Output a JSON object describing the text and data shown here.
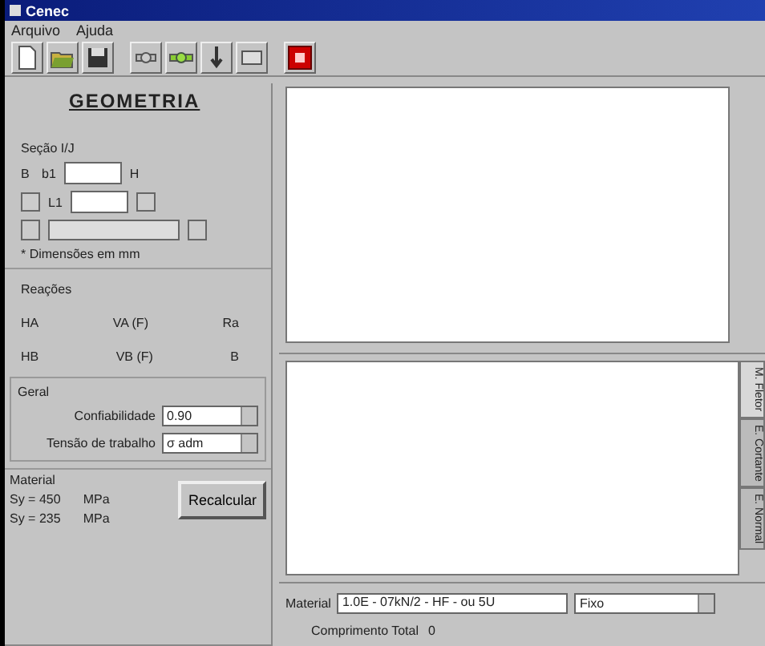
{
  "window": {
    "title": "Cenec"
  },
  "menu": [
    "Arquivo",
    "Ajuda"
  ],
  "toolbar": [
    {
      "kind": "new"
    },
    {
      "kind": "open"
    },
    {
      "kind": "save"
    },
    {
      "kind": "sep"
    },
    {
      "kind": "beam"
    },
    {
      "kind": "beam-green"
    },
    {
      "kind": "load"
    },
    {
      "kind": "support"
    },
    {
      "kind": "sep"
    },
    {
      "kind": "stop"
    }
  ],
  "geometry": {
    "title": "GEOMETRIA",
    "section_label": "Seção I/J",
    "b_label": "B",
    "b1_label": "b1",
    "h_label": "H",
    "l1_label": "L1",
    "checks": [
      {
        "checked": false
      },
      {
        "checked": false
      }
    ],
    "note": "* Dimensões em mm"
  },
  "reactions": {
    "title": "Reações",
    "rows": [
      [
        "HA",
        "VA (F)",
        "Ra"
      ],
      [
        "HB",
        "VB (F)",
        "B"
      ]
    ]
  },
  "general": {
    "title": "Geral",
    "rows": [
      {
        "label": "Confiabilidade",
        "value": "0.90"
      },
      {
        "label": "Tensão de trabalho",
        "value": "σ adm"
      }
    ]
  },
  "material": {
    "title": "Material",
    "rows": [
      [
        "Sy = 450",
        "MPa"
      ],
      [
        "Sy = 235",
        "MPa"
      ]
    ]
  },
  "recalc_button": "Recalcular",
  "bottom": {
    "material_label": "Material",
    "material_value": "1.0E - 07kN/2 - HF - ou 5U",
    "support_value": "Fixo",
    "total_label": "Comprimento Total",
    "total_value": "0"
  },
  "side_tabs": [
    {
      "label": "M. Fletor",
      "selected": true
    },
    {
      "label": "E. Cortante",
      "selected": false
    },
    {
      "label": "E. Normal",
      "selected": false
    }
  ]
}
